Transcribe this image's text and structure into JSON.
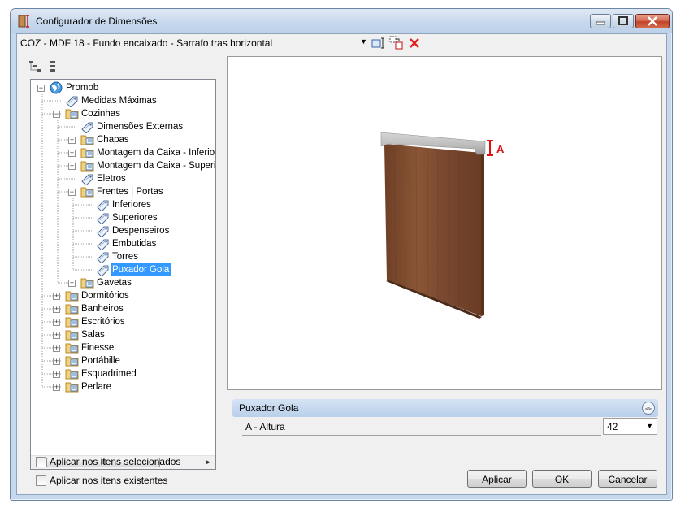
{
  "window": {
    "title": "Configurador de Dimensões"
  },
  "topbar": {
    "path": "COZ - MDF 18 - Fundo encaixado - Sarrafo tras horizontal"
  },
  "tree": {
    "items": [
      {
        "label": "Promob"
      },
      {
        "label": "Medidas Máximas"
      },
      {
        "label": "Cozinhas"
      },
      {
        "label": "Dimensões Externas"
      },
      {
        "label": "Chapas"
      },
      {
        "label": "Montagem da Caixa - Inferior"
      },
      {
        "label": "Montagem da Caixa - Superior"
      },
      {
        "label": "Eletros"
      },
      {
        "label": "Frentes | Portas"
      },
      {
        "label": "Inferiores"
      },
      {
        "label": "Superiores"
      },
      {
        "label": "Despenseiros"
      },
      {
        "label": "Embutidas"
      },
      {
        "label": "Torres"
      },
      {
        "label": "Puxador Gola"
      },
      {
        "label": "Gavetas"
      },
      {
        "label": "Dormitórios"
      },
      {
        "label": "Banheiros"
      },
      {
        "label": "Escritórios"
      },
      {
        "label": "Salas"
      },
      {
        "label": "Finesse"
      },
      {
        "label": "Portábille"
      },
      {
        "label": "Esquadrimed"
      },
      {
        "label": "Perlare"
      }
    ],
    "scroll_thumb_label": "III"
  },
  "preview": {
    "dimension_label": "A"
  },
  "properties": {
    "title": "Puxador Gola",
    "rows": [
      {
        "label": "A - Altura",
        "value": "42"
      }
    ]
  },
  "options": {
    "apply_selected": "Aplicar nos itens selecionados",
    "apply_existing": "Aplicar nos itens existentes"
  },
  "buttons": {
    "apply": "Aplicar",
    "ok": "OK",
    "cancel": "Cancelar"
  },
  "colors": {
    "selection": "#3399ff",
    "door_wood": "#7a4a30",
    "dimension_red": "#e01010"
  }
}
